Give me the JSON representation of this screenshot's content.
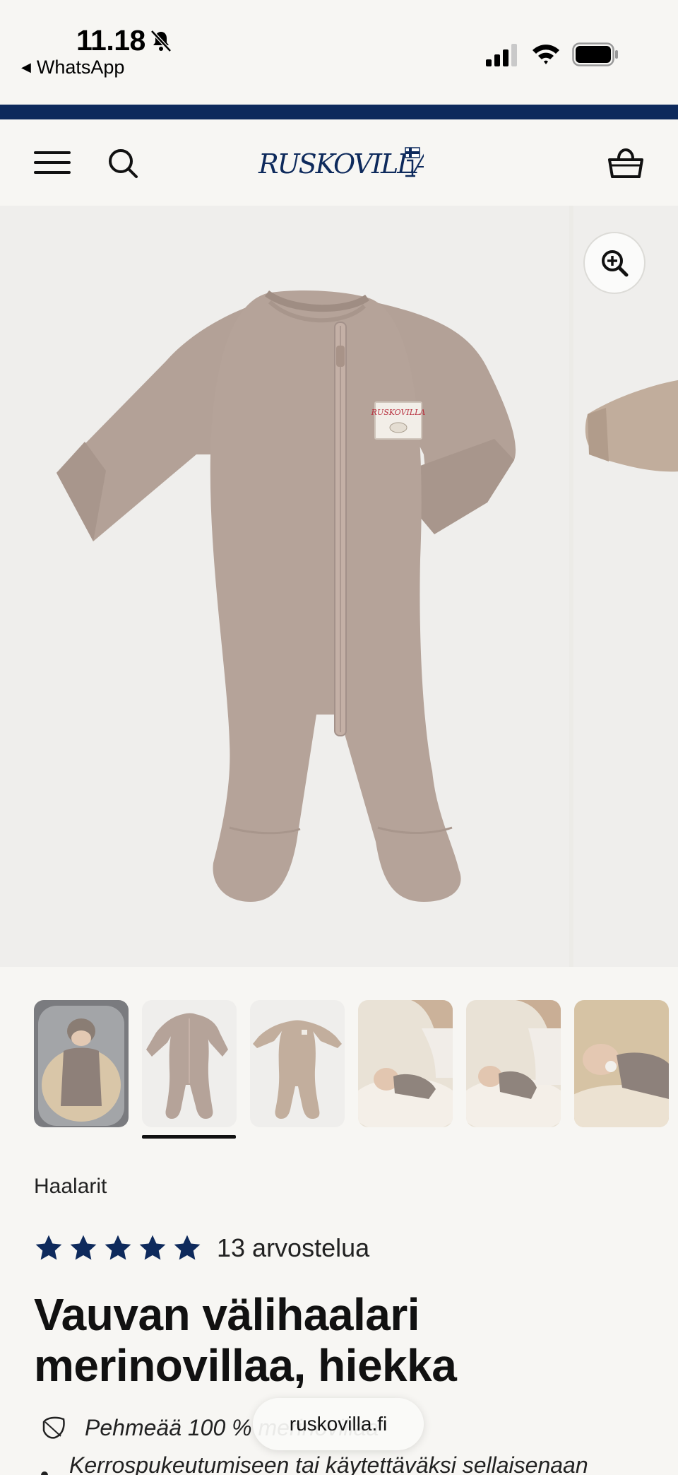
{
  "status_bar": {
    "time": "11.18",
    "back_app": "WhatsApp"
  },
  "header": {
    "logo_text": "RUSKOVILLA",
    "menu_icon": "hamburger-menu-icon",
    "search_icon": "search-icon",
    "cart_icon": "cart-basket-icon"
  },
  "gallery": {
    "zoom_icon": "zoom-in-icon",
    "badge_text": "RUSKOVILLA",
    "thumbnail_count": 6,
    "active_thumbnail": 2
  },
  "product": {
    "category": "Haalarit",
    "rating_stars": 5,
    "review_count": "13 arvostelua",
    "title": "Vauvan välihaalari merinovillaa, hiekka",
    "features": [
      "Pehmeää 100 % merinovillaa",
      "Kerrospukeutumiseen tai käytettäväksi sellaisenaan"
    ]
  },
  "browser": {
    "url": "ruskovilla.fi"
  },
  "colors": {
    "brand_navy": "#0e2a5c",
    "star": "#0e2a5c",
    "onesie": "#b5a399",
    "background": "#f7f6f3"
  }
}
